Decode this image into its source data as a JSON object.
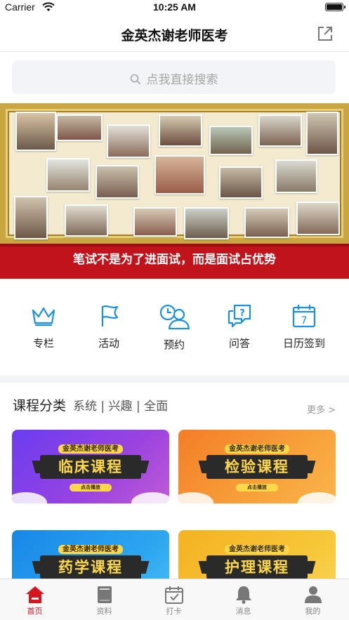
{
  "status_bar": {
    "carrier": "Carrier",
    "time": "10:25 AM"
  },
  "nav": {
    "title": "金英杰谢老师医考"
  },
  "search": {
    "placeholder": "点我直接搜索"
  },
  "banner": {
    "slogan": "笔试不是为了进面试，而是面试占优势"
  },
  "quick_links": [
    {
      "label": "专栏",
      "icon": "crown-icon"
    },
    {
      "label": "活动",
      "icon": "flag-icon"
    },
    {
      "label": "预约",
      "icon": "clock-people-icon"
    },
    {
      "label": "问答",
      "icon": "qa-chat-icon"
    },
    {
      "label": "日历签到",
      "icon": "calendar-icon"
    }
  ],
  "section": {
    "title": "课程分类",
    "subtitle": "系统 | 兴趣 | 全面",
    "more": "更多 >"
  },
  "courses": [
    {
      "brand": "金英杰谢老师医考",
      "title": "临床课程",
      "play": "点击播放",
      "color": "purple"
    },
    {
      "brand": "金英杰谢老师医考",
      "title": "检验课程",
      "play": "点击播放",
      "color": "orange"
    },
    {
      "brand": "金英杰谢老师医考",
      "title": "药学课程",
      "play": "",
      "color": "blue"
    },
    {
      "brand": "金英杰谢老师医考",
      "title": "护理课程",
      "play": "",
      "color": "yellow"
    }
  ],
  "tabs": [
    {
      "label": "首页",
      "icon": "home-icon",
      "active": true
    },
    {
      "label": "资料",
      "icon": "book-icon",
      "active": false
    },
    {
      "label": "打卡",
      "icon": "checkin-calendar-icon",
      "active": false
    },
    {
      "label": "消息",
      "icon": "bell-icon",
      "active": false
    },
    {
      "label": "我的",
      "icon": "profile-icon",
      "active": false
    }
  ],
  "colors": {
    "accent_red": "#d7151d",
    "icon_blue": "#1c8fe3",
    "strip_red": "#c1131b"
  }
}
